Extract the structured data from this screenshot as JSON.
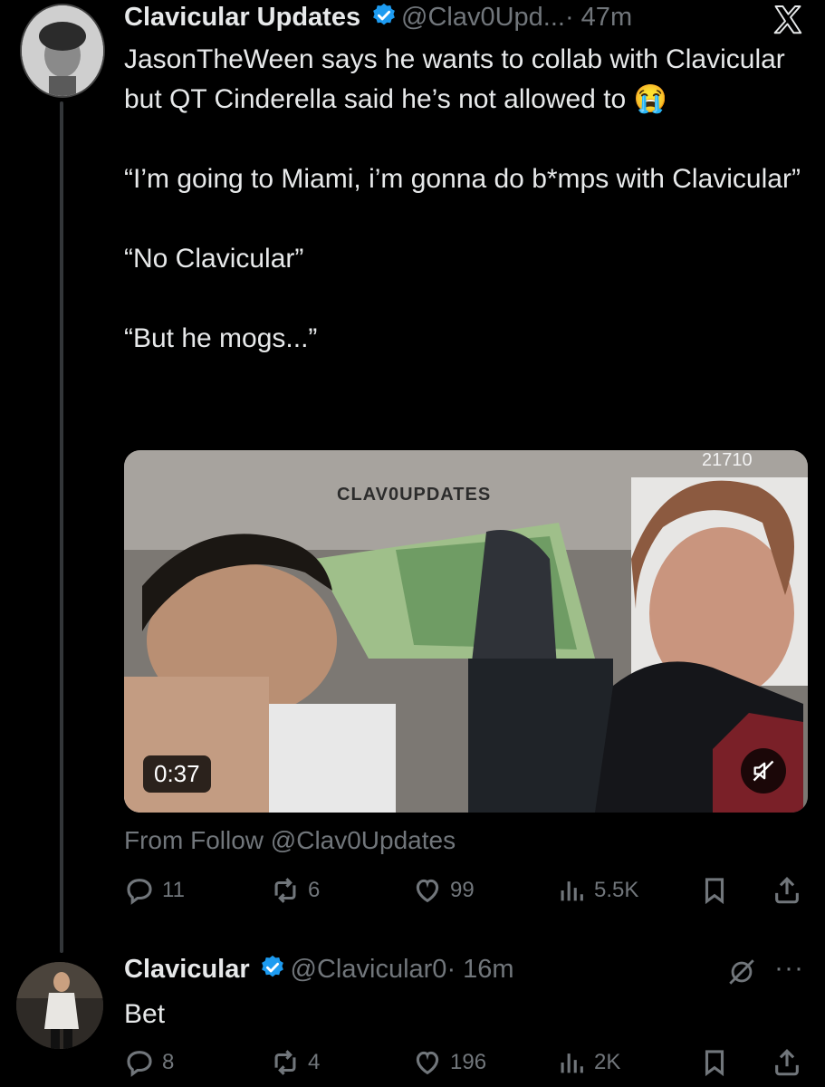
{
  "tweet1": {
    "author_name": "Clavicular Updates",
    "handle": "@Clav0Upd...",
    "time": "· 47m",
    "text": "JasonTheWeen says he wants to collab with Clavicular but QT Cinderella said he’s not allowed to 😭\n\n“I’m going to Miami, i’m gonna do b*mps with Clavicular”\n\n“No Clavicular”\n\n“But he mogs...”",
    "video": {
      "duration": "0:37",
      "watermark": "CLAV0UPDATES",
      "overlay_text": "21710"
    },
    "from_follow": "From Follow @Clav0Updates",
    "replies": "11",
    "reposts": "6",
    "likes": "99",
    "views": "5.5K"
  },
  "tweet2": {
    "author_name": "Clavicular",
    "handle": "@Clavicular0",
    "time": "· 16m",
    "text": "Bet",
    "replies": "8",
    "reposts": "4",
    "likes": "196",
    "views": "2K"
  },
  "icons": {
    "verified_color": "#1d9bf0",
    "x_logo": "x-logo-icon"
  }
}
